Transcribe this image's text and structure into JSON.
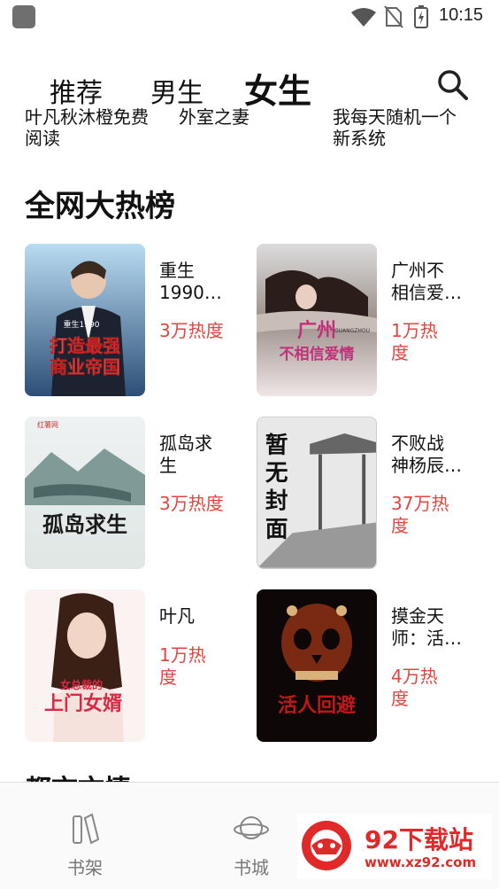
{
  "status": {
    "time": "10:15"
  },
  "tabs": [
    {
      "label": "推荐"
    },
    {
      "label": "男生"
    },
    {
      "label": "女生"
    }
  ],
  "recommend": [
    "叶凡秋沐橙免费\n阅读",
    "外室之妻",
    "我每天随机一个\n新系统"
  ],
  "section_title": "全网大热榜",
  "books": [
    {
      "title": "重生\n1990…",
      "heat": "3万热度",
      "cover_text": [
        "打造最强",
        "商业帝国"
      ],
      "cover_small": "重生1990"
    },
    {
      "title": "广州不\n相信爱…",
      "heat": "1万热\n度",
      "cover_text": [
        "广州",
        "不相信爱情"
      ],
      "cover_small": "GUANGZHOU"
    },
    {
      "title": "孤岛求\n生",
      "heat": "3万热度",
      "cover_text": [
        "孤岛求生"
      ],
      "cover_small": "红薯网"
    },
    {
      "title": "不败战\n神杨辰…",
      "heat": "37万热\n度",
      "cover_text": [
        "暂",
        "无",
        "封",
        "面"
      ],
      "cover_small": ""
    },
    {
      "title": "叶凡",
      "heat": "1万热\n度",
      "cover_text": [
        "上门女婿"
      ],
      "cover_small": "女总裁的"
    },
    {
      "title": "摸金天\n师：活…",
      "heat": "4万热\n度",
      "cover_text": [
        "活人回避"
      ],
      "cover_small": ""
    }
  ],
  "section2_title": "都市文情",
  "nav": [
    {
      "label": "书架"
    },
    {
      "label": "书城"
    }
  ],
  "watermark": {
    "name": "92下载站",
    "url": "www.xz92.com"
  }
}
